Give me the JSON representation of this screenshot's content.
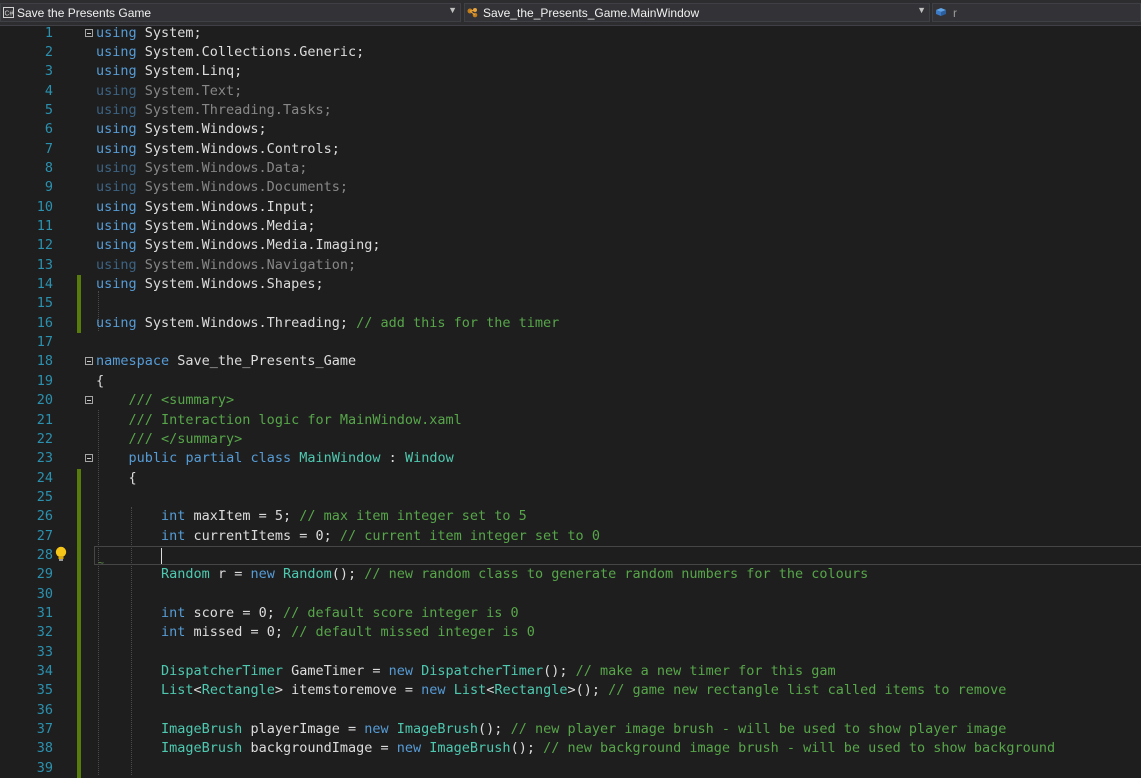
{
  "navbar": {
    "project": "Save the Presents Game",
    "type_member": "Save_the_Presents_Game.MainWindow",
    "member": "r"
  },
  "editor": {
    "lines": [
      {
        "n": "1",
        "t": "using System;"
      },
      {
        "n": "2",
        "t": "using System.Collections.Generic;"
      },
      {
        "n": "3",
        "t": "using System.Linq;"
      },
      {
        "n": "4",
        "t": "using System.Text;"
      },
      {
        "n": "5",
        "t": "using System.Threading.Tasks;"
      },
      {
        "n": "6",
        "t": "using System.Windows;"
      },
      {
        "n": "7",
        "t": "using System.Windows.Controls;"
      },
      {
        "n": "8",
        "t": "using System.Windows.Data;"
      },
      {
        "n": "9",
        "t": "using System.Windows.Documents;"
      },
      {
        "n": "10",
        "t": "using System.Windows.Input;"
      },
      {
        "n": "11",
        "t": "using System.Windows.Media;"
      },
      {
        "n": "12",
        "t": "using System.Windows.Media.Imaging;"
      },
      {
        "n": "13",
        "t": "using System.Windows.Navigation;"
      },
      {
        "n": "14",
        "t": "using System.Windows.Shapes;"
      },
      {
        "n": "15",
        "t": ""
      },
      {
        "n": "16",
        "t": "using System.Windows.Threading; // add this for the timer"
      },
      {
        "n": "17",
        "t": ""
      },
      {
        "n": "18",
        "t": "namespace Save_the_Presents_Game"
      },
      {
        "n": "19",
        "t": "{"
      },
      {
        "n": "20",
        "t": "    /// <summary>"
      },
      {
        "n": "21",
        "t": "    /// Interaction logic for MainWindow.xaml"
      },
      {
        "n": "22",
        "t": "    /// </summary>"
      },
      {
        "n": "23",
        "t": "    public partial class MainWindow : Window"
      },
      {
        "n": "24",
        "t": "    {"
      },
      {
        "n": "25",
        "t": ""
      },
      {
        "n": "26",
        "t": "        int maxItem = 5; // max item integer set to 5"
      },
      {
        "n": "27",
        "t": "        int currentItems = 0; // current item integer set to 0"
      },
      {
        "n": "28",
        "t": ""
      },
      {
        "n": "29",
        "t": "        Random r = new Random(); // new random class to generate random numbers for the colours"
      },
      {
        "n": "30",
        "t": ""
      },
      {
        "n": "31",
        "t": "        int score = 0; // default score integer is 0"
      },
      {
        "n": "32",
        "t": "        int missed = 0; // default missed integer is 0"
      },
      {
        "n": "33",
        "t": ""
      },
      {
        "n": "34",
        "t": "        DispatcherTimer GameTimer = new DispatcherTimer(); // make a new timer for this gam"
      },
      {
        "n": "35",
        "t": "        List<Rectangle> itemstoremove = new List<Rectangle>(); // game new rectangle list called items to remove"
      },
      {
        "n": "36",
        "t": ""
      },
      {
        "n": "37",
        "t": "        ImageBrush playerImage = new ImageBrush(); // new player image brush - will be used to show player image"
      },
      {
        "n": "38",
        "t": "        ImageBrush backgroundImage = new ImageBrush(); // new background image brush - will be used to show background"
      },
      {
        "n": "39",
        "t": ""
      }
    ]
  },
  "colors": {
    "keyword": "#569cd6",
    "type": "#4ec9b0",
    "comment": "#57a64a",
    "line_number": "#2b91af",
    "change_marker": "#587c0c",
    "background": "#1e1e1e"
  },
  "icons": {
    "project": "csharp-project-icon",
    "class": "class-icon",
    "member": "field-icon",
    "quick_action": "lightbulb-icon"
  }
}
